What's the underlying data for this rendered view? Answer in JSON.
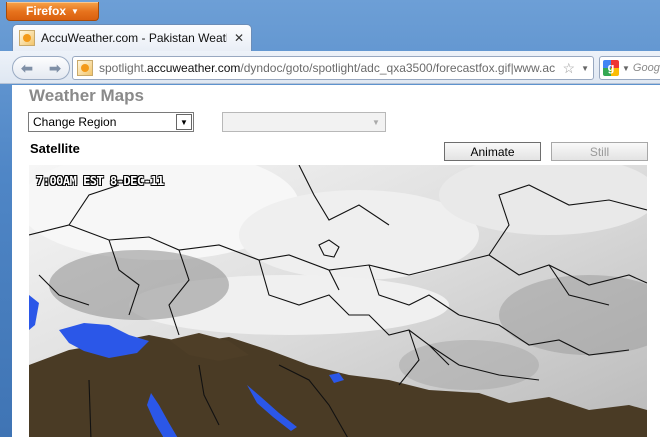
{
  "browser": {
    "menu_label": "Firefox",
    "tab_title": "AccuWeather.com - Pakistan Weathe...",
    "url_prefix": "spotlight.",
    "url_domain": "accuweather.com",
    "url_path": "/dyndoc/goto/spotlight/adc_qxa3500/forecastfox.gif|www.ac",
    "search_text": "Goog"
  },
  "page": {
    "title": "Weather Maps",
    "region_select": "Change Region",
    "sub_select": "",
    "section_label": "Satellite",
    "animate_label": "Animate",
    "still_label": "Still",
    "timestamp": "7:00AM EST 8-DEC-11"
  },
  "colors": {
    "land_desert": "#4a3b25",
    "water_blue": "#2b57e8",
    "cloud_white": "#f4f4f4"
  }
}
